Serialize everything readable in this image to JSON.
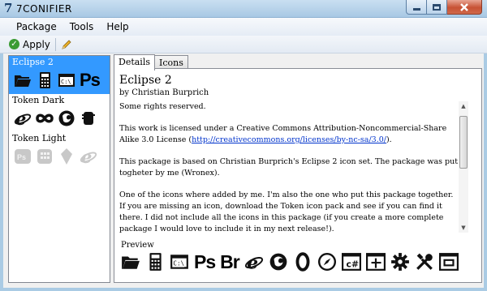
{
  "window": {
    "title": "7CONIFIER",
    "app_glyph": "7"
  },
  "menu": [
    "Package",
    "Tools",
    "Help"
  ],
  "toolbar": {
    "apply_label": "Apply"
  },
  "packages": [
    {
      "name": "Eclipse 2",
      "selected": true,
      "icons": [
        "folder-icon",
        "calculator-icon",
        "terminal-icon",
        "ps-text"
      ]
    },
    {
      "name": "Token Dark",
      "selected": false,
      "icons": [
        "ie-icon",
        "infinity-icon",
        "firefox-icon",
        "device-icon"
      ]
    },
    {
      "name": "Token Light",
      "selected": false,
      "icons": [
        "ps-box-icon",
        "calculator-icon",
        "shield-icon",
        "ie-icon"
      ]
    }
  ],
  "tabs": [
    {
      "label": "Details",
      "active": true
    },
    {
      "label": "Icons",
      "active": false
    }
  ],
  "details": {
    "title": "Eclipse 2",
    "author": "by Christian Burprich",
    "paragraphs": [
      "Some rights reserved.",
      "This work is licensed under a Creative Commons Attribution-Noncommercial-Share Alike 3.0 License",
      "This package is based on Christian Burprich's Eclipse 2 icon set. The package was put togheter by me (Wronex).",
      "One of the icons where added by me. I'm also the one who put this package together. If you are missing an icon, download the Token icon pack and see if you can find it there. I did not include all the icons in this package (if you create a more complete package I would love to include it in my next release!)."
    ],
    "license_link": "http://creativecommons.org/licenses/by-nc-sa/3.0/",
    "link_open": "(",
    "link_close": ")."
  },
  "preview": {
    "label": "Preview",
    "ps": "Ps",
    "br": "Br",
    "icons": [
      "folder-icon",
      "calculator-icon",
      "terminal-icon",
      "ps-text",
      "br-text",
      "ie-icon",
      "firefox-icon",
      "opera-icon",
      "compass-icon",
      "csharp-icon",
      "move-icon",
      "gear-icon",
      "tools-icon",
      "window-icon"
    ]
  }
}
